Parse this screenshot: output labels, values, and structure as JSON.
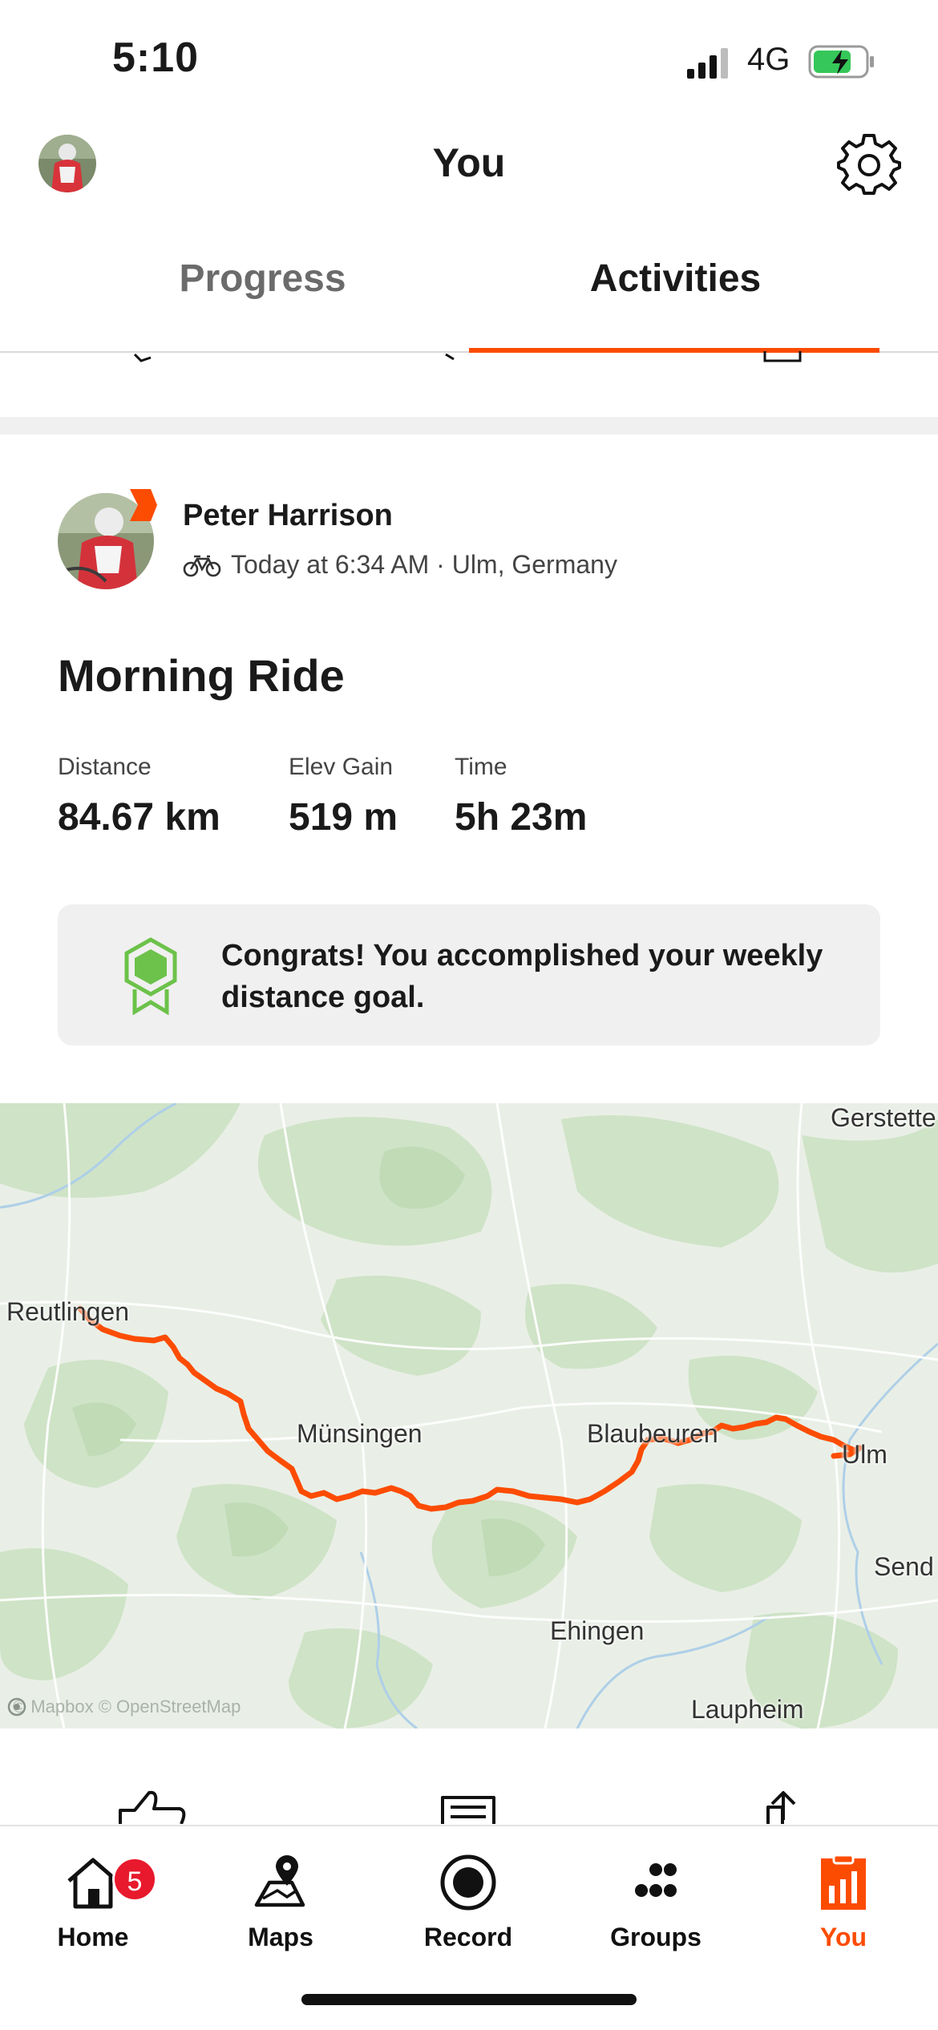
{
  "status_bar": {
    "time": "5:10",
    "network": "4G"
  },
  "header": {
    "title": "You"
  },
  "tabs": [
    {
      "label": "Progress",
      "active": false
    },
    {
      "label": "Activities",
      "active": true
    }
  ],
  "activity": {
    "athlete_name": "Peter Harrison",
    "meta": "Today at 6:34 AM · Ulm, Germany",
    "title": "Morning Ride",
    "stats": [
      {
        "label": "Distance",
        "value": "84.67 km"
      },
      {
        "label": "Elev Gain",
        "value": "519 m"
      },
      {
        "label": "Time",
        "value": "5h 23m"
      }
    ],
    "goal_message": "Congrats! You accomplished your weekly distance goal."
  },
  "map": {
    "labels": {
      "reutlingen": "Reutlingen",
      "muensingen": "Münsingen",
      "blaubeuren": "Blaubeuren",
      "ulm": "Ulm",
      "ehingen": "Ehingen",
      "laupheim": "Laupheim",
      "gerstetten": "Gerstette",
      "sendern": "Send"
    },
    "attribution": "© Mapbox © OpenStreetMap",
    "route_color": "#fc4c02"
  },
  "bottom_nav": [
    {
      "label": "Home",
      "badge": "5",
      "icon": "home-icon"
    },
    {
      "label": "Maps",
      "icon": "map-pin-icon"
    },
    {
      "label": "Record",
      "icon": "record-icon"
    },
    {
      "label": "Groups",
      "icon": "groups-icon"
    },
    {
      "label": "You",
      "icon": "you-chart-icon",
      "active": true
    }
  ],
  "colors": {
    "accent": "#fc4c02",
    "badge": "#e8192c",
    "goal_green": "#6cc24a"
  }
}
